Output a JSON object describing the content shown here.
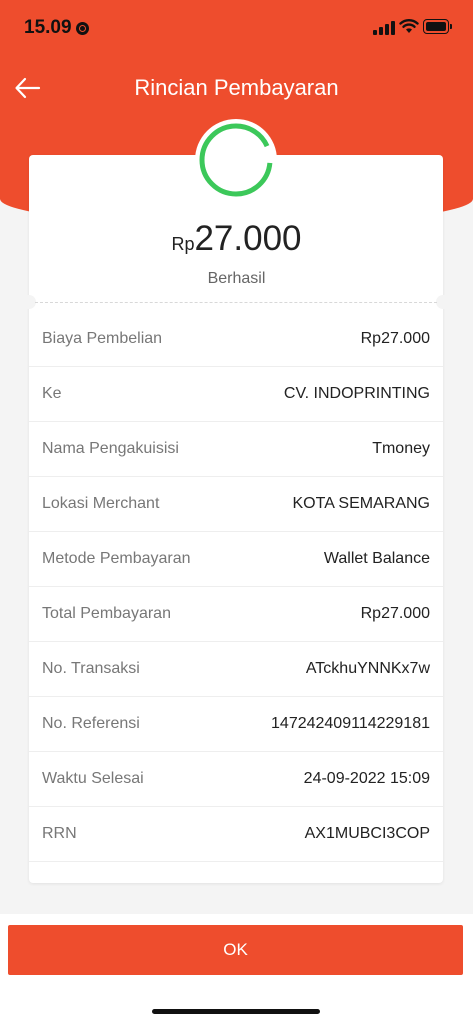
{
  "status_bar": {
    "time": "15.09"
  },
  "nav": {
    "title": "Rincian Pembayaran"
  },
  "summary": {
    "currency": "Rp",
    "amount": "27.000",
    "status": "Berhasil"
  },
  "details": [
    {
      "label": "Biaya Pembelian",
      "value": "Rp27.000"
    },
    {
      "label": "Ke",
      "value": "CV. INDOPRINTING"
    },
    {
      "label": "Nama Pengakuisisi",
      "value": "Tmoney"
    },
    {
      "label": "Lokasi Merchant",
      "value": "KOTA SEMARANG"
    },
    {
      "label": "Metode Pembayaran",
      "value": "Wallet Balance"
    },
    {
      "label": "Total Pembayaran",
      "value": "Rp27.000"
    },
    {
      "label": "No. Transaksi",
      "value": "ATckhuYNNKx7w"
    },
    {
      "label": "No. Referensi",
      "value": "147242409114229181"
    },
    {
      "label": "Waktu Selesai",
      "value": "24-09-2022 15:09"
    },
    {
      "label": "RRN",
      "value": "AX1MUBCI3COP"
    }
  ],
  "actions": {
    "ok_label": "OK"
  },
  "colors": {
    "accent": "#ee4d2d",
    "success": "#3cc85a",
    "background": "#f4f4f4"
  },
  "icons": [
    "back-arrow-icon",
    "success-progress-icon",
    "signal-icon",
    "wifi-icon",
    "battery-icon",
    "location-icon"
  ]
}
